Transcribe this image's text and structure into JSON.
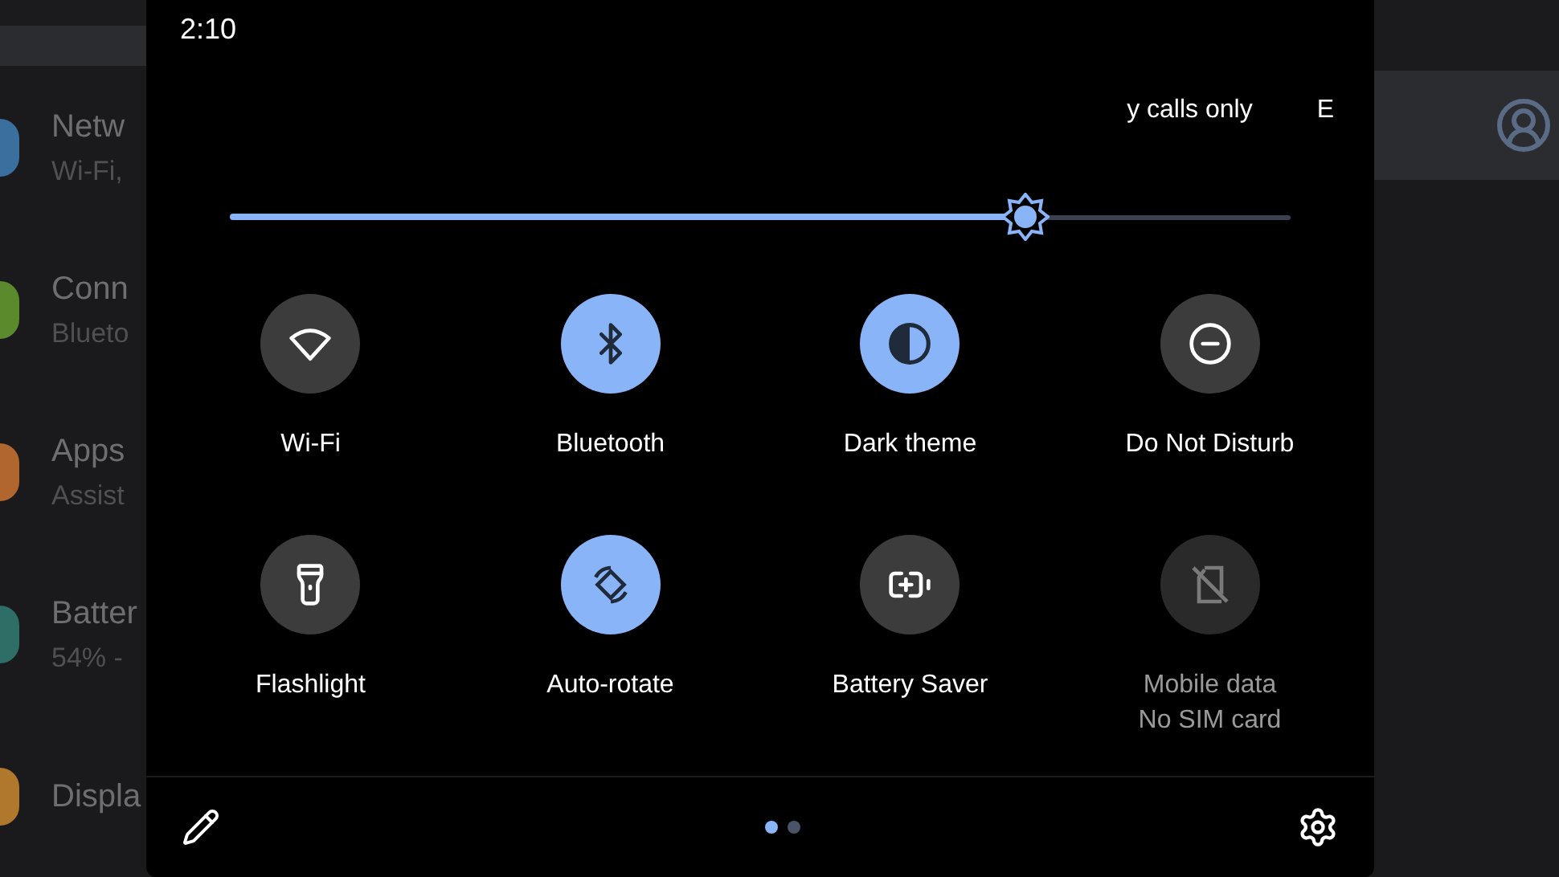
{
  "background_settings": {
    "items": [
      {
        "title": "Netw",
        "subtitle": "Wi-Fi,",
        "color": "#3a6f9e"
      },
      {
        "title": "Conn",
        "subtitle": "Blueto",
        "color": "#5b8a2c"
      },
      {
        "title": "Apps",
        "subtitle": "Assist",
        "color": "#b0662c"
      },
      {
        "title": "Batter",
        "subtitle": "54% -",
        "color": "#2d6e66"
      },
      {
        "title": "Displa",
        "color": "#b0782c"
      }
    ]
  },
  "quick_settings": {
    "time": "2:10",
    "carrier_text": "y calls only",
    "network_text": "E",
    "brightness": {
      "level": 0.75
    },
    "tiles": [
      {
        "label": "Wi-Fi",
        "on": false,
        "disabled": false
      },
      {
        "label": "Bluetooth",
        "on": true,
        "disabled": false
      },
      {
        "label": "Dark theme",
        "on": true,
        "disabled": false
      },
      {
        "label": "Do Not Disturb",
        "on": false,
        "disabled": false
      },
      {
        "label": "Flashlight",
        "on": false,
        "disabled": false
      },
      {
        "label": "Auto-rotate",
        "on": true,
        "disabled": false
      },
      {
        "label": "Battery Saver",
        "on": false,
        "disabled": false
      },
      {
        "label": "Mobile data",
        "secondary": "No SIM card",
        "disabled": true
      }
    ],
    "pages": [
      {
        "selected": true
      },
      {
        "selected": false
      }
    ]
  }
}
